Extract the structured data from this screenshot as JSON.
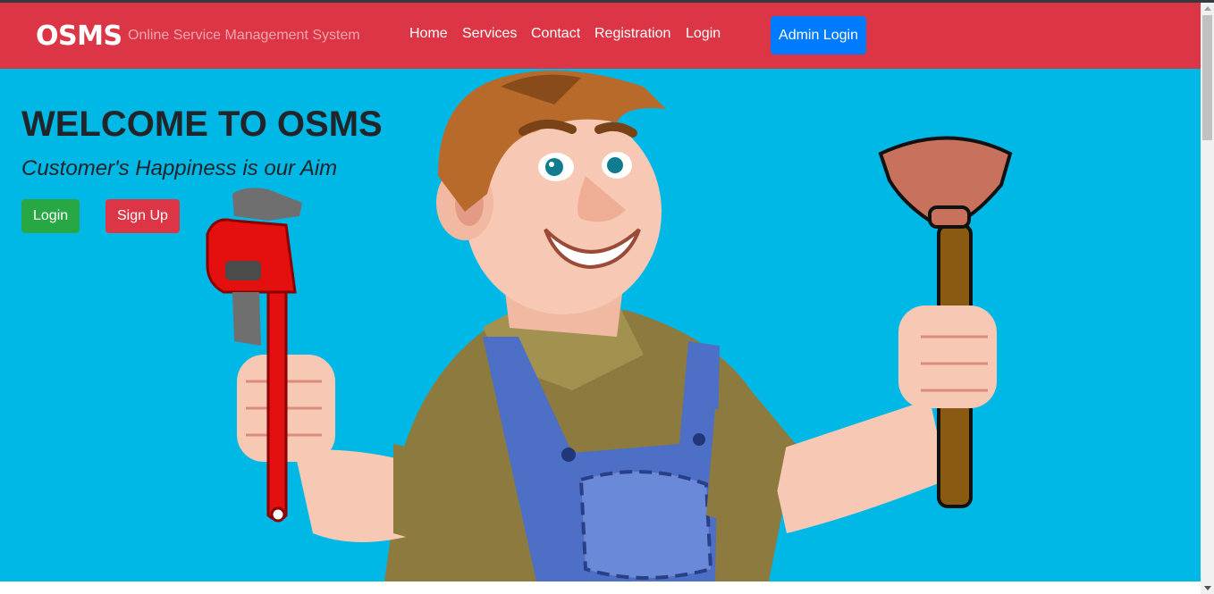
{
  "navbar": {
    "brand": "OSMS",
    "tagline": "Online Service Management System",
    "links": [
      "Home",
      "Services",
      "Contact",
      "Registration",
      "Login"
    ],
    "admin_button": "Admin Login"
  },
  "hero": {
    "title": "WELCOME TO OSMS",
    "subtitle": "Customer's Happiness is our Aim",
    "login_button": "Login",
    "signup_button": "Sign Up"
  },
  "colors": {
    "navbar_bg": "#dc3545",
    "hero_bg": "#00b8e6",
    "admin_button": "#007bff",
    "login_button": "#28a745",
    "signup_button": "#dc3545"
  },
  "icons": {
    "hero_image": "plumber-illustration",
    "wrench": "wrench-icon",
    "plunger": "plunger-icon"
  }
}
